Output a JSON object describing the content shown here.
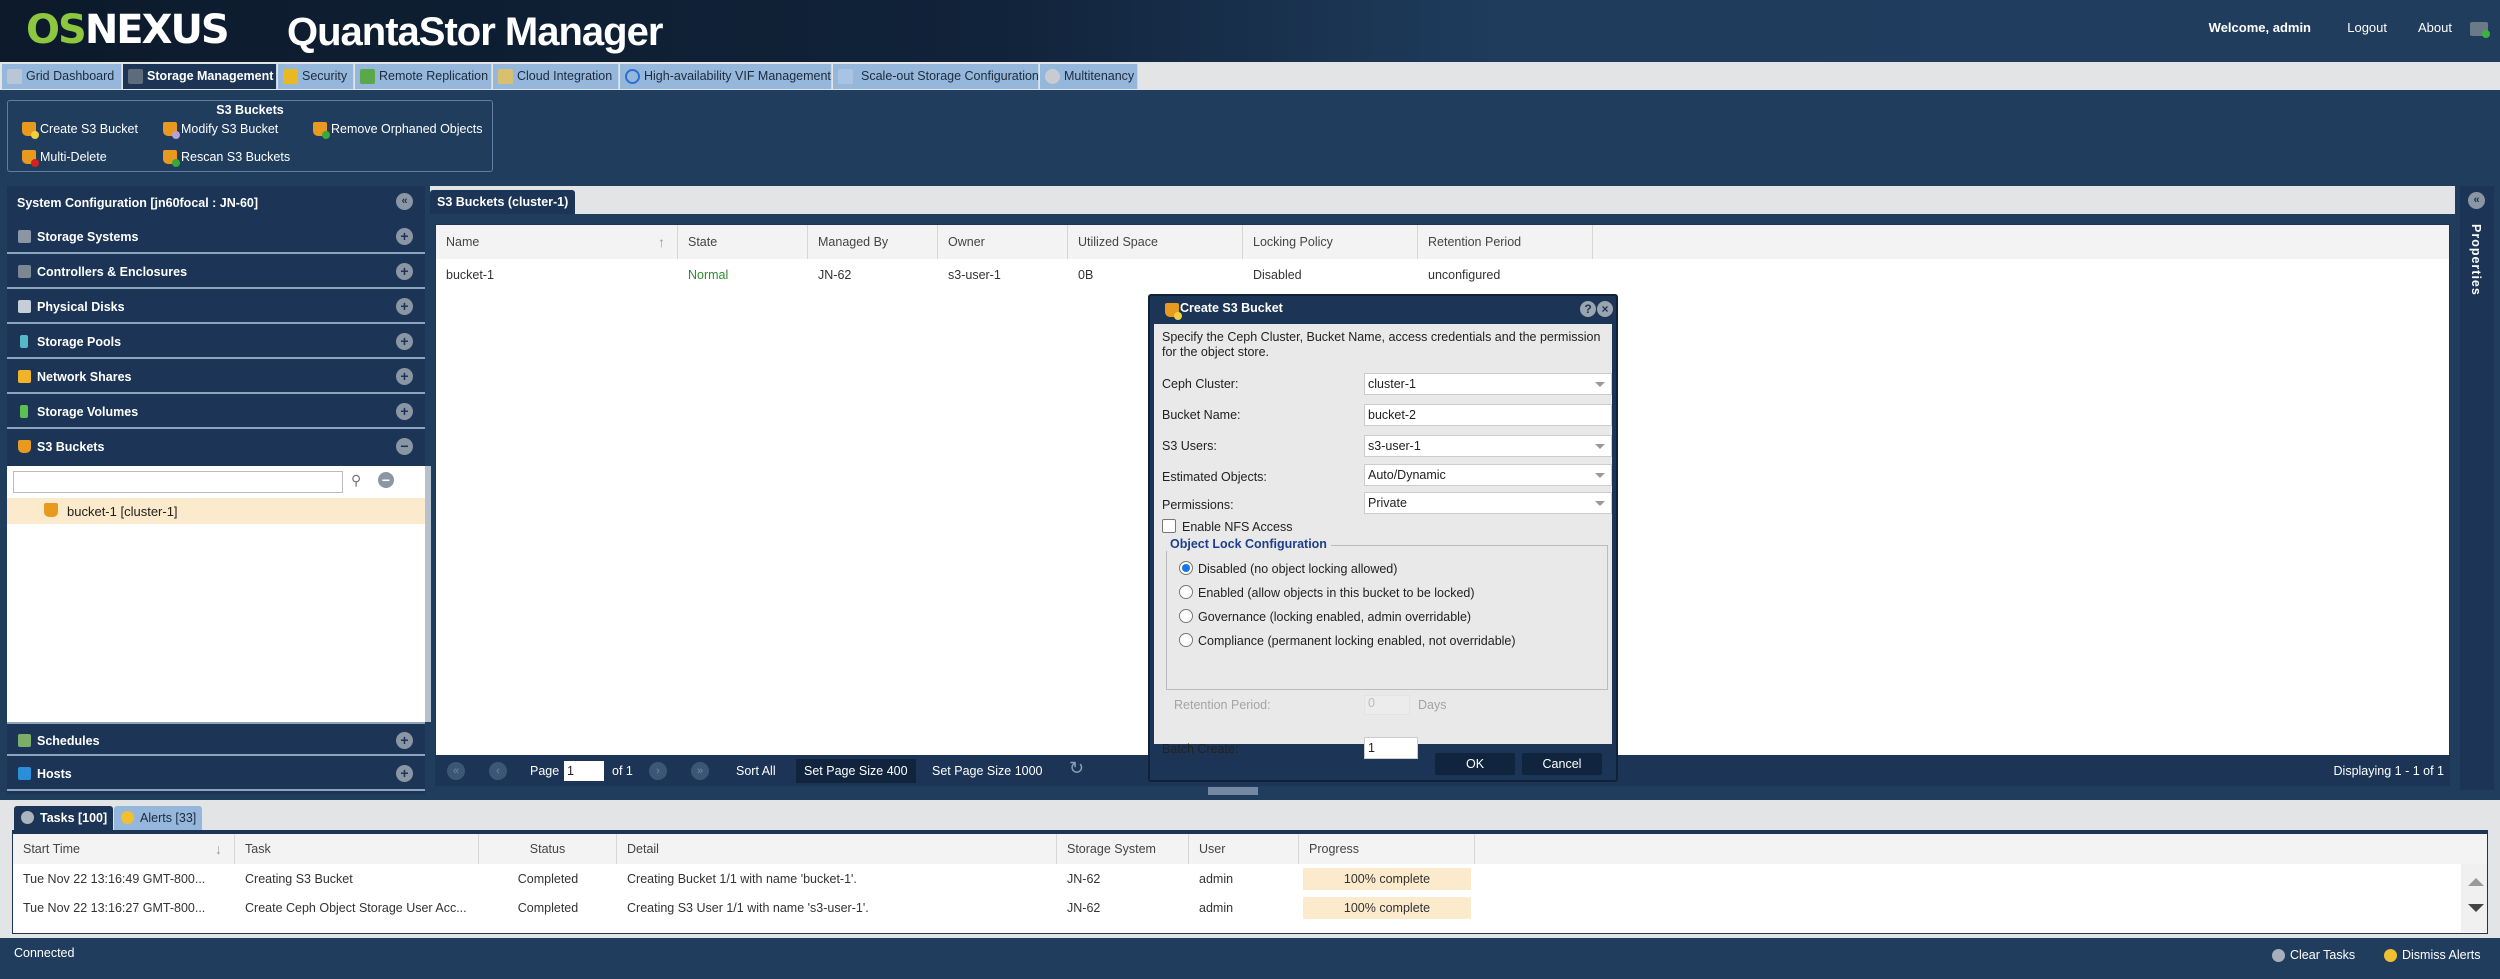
{
  "header": {
    "logo_part1": "OS",
    "logo_part2": "NEXUS",
    "app_title": "QuantaStor Manager",
    "welcome": "Welcome, admin",
    "logout": "Logout",
    "about": "About"
  },
  "main_tabs": [
    {
      "label": "Grid Dashboard",
      "icon": "grid-icon"
    },
    {
      "label": "Storage Management",
      "icon": "storage-icon",
      "active": true
    },
    {
      "label": "Security",
      "icon": "lock-icon"
    },
    {
      "label": "Remote Replication",
      "icon": "replication-icon"
    },
    {
      "label": "Cloud Integration",
      "icon": "cloud-icon"
    },
    {
      "label": "High-availability VIF Management",
      "icon": "ha-icon"
    },
    {
      "label": "Scale-out Storage Configuration",
      "icon": "scaleout-icon"
    },
    {
      "label": "Multitenancy",
      "icon": "multitenancy-icon"
    }
  ],
  "ribbon": {
    "title": "S3 Buckets",
    "buttons": [
      {
        "label": "Create S3 Bucket",
        "icon": "bucket-add-icon"
      },
      {
        "label": "Modify S3 Bucket",
        "icon": "bucket-edit-icon"
      },
      {
        "label": "Remove Orphaned Objects",
        "icon": "bucket-cleanup-icon"
      },
      {
        "label": "Multi-Delete",
        "icon": "bucket-delete-icon"
      },
      {
        "label": "Rescan S3 Buckets",
        "icon": "bucket-rescan-icon"
      }
    ]
  },
  "left_panel": {
    "title": "System Configuration [jn60focal : JN-60]",
    "items": [
      {
        "label": "Storage Systems",
        "icon": "storage-systems-icon"
      },
      {
        "label": "Controllers & Enclosures",
        "icon": "controllers-icon"
      },
      {
        "label": "Physical Disks",
        "icon": "disk-icon"
      },
      {
        "label": "Storage Pools",
        "icon": "pool-icon"
      },
      {
        "label": "Network Shares",
        "icon": "share-icon"
      },
      {
        "label": "Storage Volumes",
        "icon": "volume-icon"
      },
      {
        "label": "S3 Buckets",
        "icon": "bucket-icon",
        "expanded": true
      }
    ],
    "search_value": "",
    "tree_items": [
      {
        "label": "bucket-1 [cluster-1]"
      }
    ],
    "bottom_items": [
      {
        "label": "Schedules",
        "icon": "schedule-icon"
      },
      {
        "label": "Hosts",
        "icon": "host-icon"
      }
    ]
  },
  "center": {
    "tab_label": "S3 Buckets (cluster-1)",
    "columns": [
      "Name",
      "State",
      "Managed By",
      "Owner",
      "Utilized Space",
      "Locking Policy",
      "Retention Period"
    ],
    "rows": [
      {
        "name": "bucket-1",
        "state": "Normal",
        "managed_by": "JN-62",
        "owner": "s3-user-1",
        "utilized": "0B",
        "locking": "Disabled",
        "retention": "unconfigured"
      }
    ],
    "pager": {
      "page_label": "Page",
      "page_value": "1",
      "of_label": "of 1",
      "sort_all": "Sort All",
      "page_size_400": "Set Page Size 400",
      "page_size_1000": "Set Page Size 1000",
      "displaying": "Displaying 1 - 1 of 1"
    }
  },
  "properties_label": "Properties",
  "dialog": {
    "title": "Create S3 Bucket",
    "description": "Specify the Ceph Cluster, Bucket Name, access credentials and the permission for the object store.",
    "fields": {
      "ceph_cluster_label": "Ceph Cluster:",
      "ceph_cluster_value": "cluster-1",
      "bucket_name_label": "Bucket Name:",
      "bucket_name_value": "bucket-2",
      "s3_users_label": "S3 Users:",
      "s3_users_value": "s3-user-1",
      "estimated_objects_label": "Estimated Objects:",
      "estimated_objects_value": "Auto/Dynamic",
      "permissions_label": "Permissions:",
      "permissions_value": "Private",
      "nfs_label": "Enable NFS Access",
      "nfs_checked": false
    },
    "lock_config": {
      "legend": "Object Lock Configuration",
      "options": [
        {
          "label": "Disabled (no object locking allowed)",
          "checked": true
        },
        {
          "label": "Enabled (allow objects in this bucket to be locked)",
          "checked": false
        },
        {
          "label": "Governance (locking enabled, admin overridable)",
          "checked": false
        },
        {
          "label": "Compliance (permanent locking enabled, not overridable)",
          "checked": false
        }
      ],
      "retention_label": "Retention Period:",
      "retention_value": "0",
      "retention_unit": "Days"
    },
    "batch_label": "Batch Create:",
    "batch_value": "1",
    "ok": "OK",
    "cancel": "Cancel"
  },
  "bottom": {
    "tabs": [
      {
        "label": "Tasks [100]",
        "icon": "gears-icon",
        "active": true
      },
      {
        "label": "Alerts [33]",
        "icon": "bell-icon"
      }
    ],
    "columns": [
      "Start Time",
      "Task",
      "Status",
      "Detail",
      "Storage System",
      "User",
      "Progress"
    ],
    "rows": [
      {
        "start": "Tue Nov 22 13:16:49 GMT-800...",
        "task": "Creating S3 Bucket",
        "status": "Completed",
        "detail": "Creating Bucket 1/1 with name 'bucket-1'.",
        "system": "JN-62",
        "user": "admin",
        "progress": "100% complete",
        "progress_value": 100
      },
      {
        "start": "Tue Nov 22 13:16:27 GMT-800...",
        "task": "Create Ceph Object Storage User Acc...",
        "status": "Completed",
        "detail": "Creating S3 User 1/1 with name 's3-user-1'.",
        "system": "JN-62",
        "user": "admin",
        "progress": "100% complete",
        "progress_value": 100
      }
    ]
  },
  "statusbar": {
    "connected": "Connected",
    "clear_tasks": "Clear Tasks",
    "dismiss_alerts": "Dismiss Alerts"
  },
  "colors": {
    "brand_green": "#8dc63f",
    "navy": "#1c3556",
    "status_ok": "#2e8b2e",
    "progress_fill": "#fbeacb"
  }
}
